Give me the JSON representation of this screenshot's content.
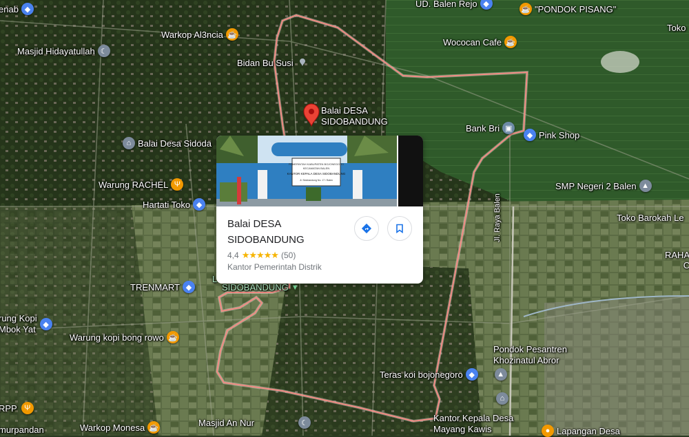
{
  "places": {
    "ud_balen_rejo": "UD. Balen Rejo",
    "pondok_pisang": "\"PONDOK PISANG\"",
    "toko_edge": "Toko",
    "enab": "enab",
    "warkop_al3ncia": "Warkop Al3ncia",
    "masjid_hidayatullah": "Masjid Hidayatullah",
    "wococan_cafe": "Wococan Cafe",
    "bidan_bu_susi": "Bidan Bu Susi",
    "balai_desa_sidobandung_pin": "Balai DESA\nSIDOBANDUNG",
    "bank_bri": "Bank Bri",
    "pink_shop": "Pink Shop",
    "balai_desa_sidoda": "Balai Desa Sidoda",
    "warung_rachel": "Warung RACHEL",
    "smp_negeri_2_balen": "SMP Negeri 2 Balen",
    "hartati_toko": "Hartati Toko",
    "toko_barokah": "Toko Barokah Le",
    "raha": "RAHA",
    "raha_c": "C",
    "trenmart": "TRENMART",
    "sidobandung_area": "SIDOBANDUNG",
    "sidobandung_area_prefix": "L",
    "jl_raya_balen": "Jl. Raya Balen",
    "warung_kopi_mbok_yat": "rung Kopi\nMbok Yat",
    "warung_kopi_bong_rowo": "Warung kopi bong rowo",
    "pondok_pesantren": "Pondok Pesantren\nKhozinatul Abror",
    "teras_koi": "Teras koi bojonegoro",
    "rpp": "RPP",
    "kantor_kepala_desa_mayang": "Kantor Kepala Desa\nMayang Kawis",
    "warkop_monesa": "Warkop Monesa",
    "masjid_an_nur": "Masjid An Nur",
    "murpandan": "murpandan",
    "lapangan_desa": "Lapangan Desa"
  },
  "card": {
    "name": "Balai DESA\nSIDOBANDUNG",
    "rating": "4,4",
    "stars": "★★★★★",
    "reviews": "(50)",
    "category": "Kantor Pemerintah Distrik",
    "photo_sign_line1": "PEMERINTAH KABUPATEN BOJONEGORO",
    "photo_sign_line2": "KECAMATAN BALEN",
    "photo_sign_line3": "KANTOR KEPALA DESA SIDOBANDUNG",
    "photo_sign_line4": "Jl. Sidobandung No. 17 / Balen"
  },
  "icons": {
    "directions": "directions-icon",
    "save": "bookmark-icon"
  },
  "colors": {
    "boundary": "#f28b82",
    "marker": "#ea4335",
    "cafe": "#f29900",
    "shop": "#4a82f0",
    "institution": "#7d8b9c"
  }
}
